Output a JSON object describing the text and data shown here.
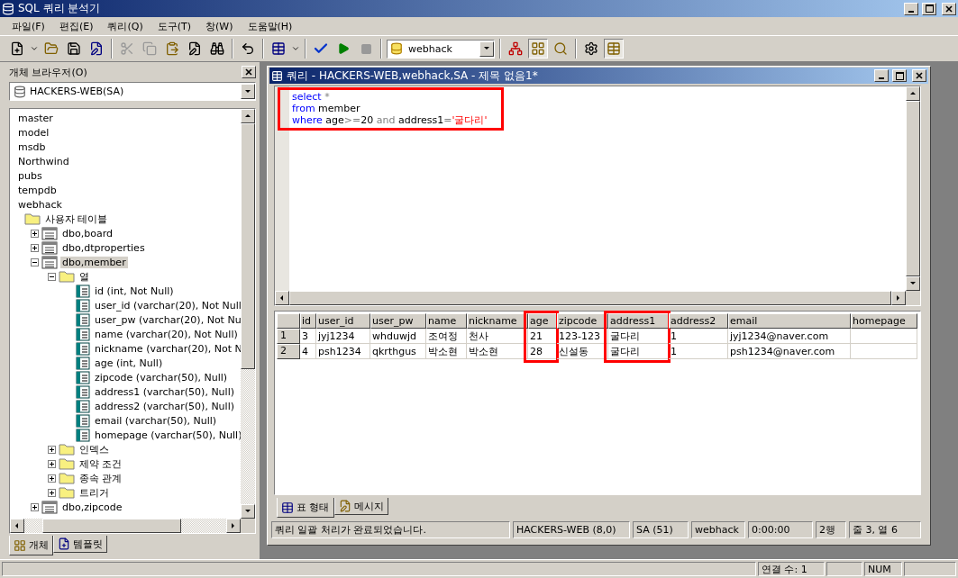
{
  "window": {
    "title": "SQL 쿼리 분석기"
  },
  "menu": [
    {
      "label": "파일(F)"
    },
    {
      "label": "편집(E)"
    },
    {
      "label": "쿼리(Q)"
    },
    {
      "label": "도구(T)"
    },
    {
      "label": "창(W)"
    },
    {
      "label": "도움말(H)"
    }
  ],
  "toolbar": {
    "database": "webhack"
  },
  "object_browser": {
    "title": "개체 브라우저(O)",
    "server": "HACKERS-WEB(SA)",
    "tree": [
      {
        "label": "master",
        "kind": "db",
        "selected": false
      },
      {
        "label": "model",
        "kind": "db",
        "selected": false
      },
      {
        "label": "msdb",
        "kind": "db",
        "selected": false
      },
      {
        "label": "Northwind",
        "kind": "db",
        "selected": false
      },
      {
        "label": "pubs",
        "kind": "db",
        "selected": false
      },
      {
        "label": "tempdb",
        "kind": "db",
        "selected": false
      },
      {
        "label": "webhack",
        "kind": "db",
        "selected": false
      },
      {
        "label": "사용자 테이블",
        "kind": "folder",
        "selected": false,
        "children": [
          {
            "label": "dbo,board",
            "kind": "table",
            "selected": false,
            "expanded": false
          },
          {
            "label": "dbo,dtproperties",
            "kind": "table",
            "selected": false,
            "expanded": false
          },
          {
            "label": "dbo,member",
            "kind": "table",
            "selected": true,
            "expanded": true,
            "children": [
              {
                "label": "열",
                "kind": "folder",
                "selected": false,
                "expanded": true,
                "children": [
                  {
                    "label": "id (int, Not Null)",
                    "kind": "column",
                    "selected": false
                  },
                  {
                    "label": "user_id (varchar(20), Not Null",
                    "kind": "column",
                    "selected": false
                  },
                  {
                    "label": "user_pw (varchar(20), Not Nu",
                    "kind": "column",
                    "selected": false
                  },
                  {
                    "label": "name (varchar(20), Not Null)",
                    "kind": "column",
                    "selected": false
                  },
                  {
                    "label": "nickname (varchar(20), Not N",
                    "kind": "column",
                    "selected": false
                  },
                  {
                    "label": "age (int, Null)",
                    "kind": "column",
                    "selected": false
                  },
                  {
                    "label": "zipcode (varchar(50), Null)",
                    "kind": "column",
                    "selected": false
                  },
                  {
                    "label": "address1 (varchar(50), Null)",
                    "kind": "column",
                    "selected": false
                  },
                  {
                    "label": "address2 (varchar(50), Null)",
                    "kind": "column",
                    "selected": false
                  },
                  {
                    "label": "email (varchar(50), Null)",
                    "kind": "column",
                    "selected": false
                  },
                  {
                    "label": "homepage (varchar(50), Null)",
                    "kind": "column",
                    "selected": false
                  }
                ]
              },
              {
                "label": "인덱스",
                "kind": "folder",
                "selected": false,
                "expanded": false
              },
              {
                "label": "제약 조건",
                "kind": "folder",
                "selected": false,
                "expanded": false
              },
              {
                "label": "종속 관계",
                "kind": "folder",
                "selected": false,
                "expanded": false
              },
              {
                "label": "트리거",
                "kind": "folder",
                "selected": false,
                "expanded": false
              }
            ]
          },
          {
            "label": "dbo,zipcode",
            "kind": "table",
            "selected": false,
            "expanded": false
          }
        ]
      }
    ],
    "tabs": [
      {
        "label": "개체",
        "selected": true
      },
      {
        "label": "템플릿",
        "selected": false
      }
    ]
  },
  "query_window": {
    "title": "쿼리 - HACKERS-WEB,webhack,SA - 제목 없음1*",
    "query": {
      "highlighted": true,
      "lines": [
        [
          {
            "kind": "keyword",
            "text": "select"
          },
          {
            "kind": "operator",
            "text": " *"
          }
        ],
        [
          {
            "kind": "keyword",
            "text": "from"
          },
          {
            "kind": "plain",
            "text": " member"
          }
        ],
        [
          {
            "kind": "keyword",
            "text": "where"
          },
          {
            "kind": "plain",
            "text": " age"
          },
          {
            "kind": "operator",
            "text": ">="
          },
          {
            "kind": "plain",
            "text": "20"
          },
          {
            "kind": "operator",
            "text": " and "
          },
          {
            "kind": "plain",
            "text": "address1"
          },
          {
            "kind": "operator",
            "text": "="
          },
          {
            "kind": "string",
            "text": "'굴다리'"
          }
        ]
      ]
    },
    "grid": {
      "columns": [
        {
          "label": "id",
          "highlighted": false
        },
        {
          "label": "user_id",
          "highlighted": false
        },
        {
          "label": "user_pw",
          "highlighted": false
        },
        {
          "label": "name",
          "highlighted": false
        },
        {
          "label": "nickname",
          "highlighted": false
        },
        {
          "label": "age",
          "highlighted": true
        },
        {
          "label": "zipcode",
          "highlighted": false
        },
        {
          "label": "address1",
          "highlighted": true
        },
        {
          "label": "address2",
          "highlighted": false
        },
        {
          "label": "email",
          "highlighted": false
        },
        {
          "label": "homepage",
          "highlighted": false
        }
      ],
      "rows": [
        {
          "number": "1",
          "cells": [
            "3",
            "jyj1234",
            "whduwjd",
            "조여정",
            "천사",
            "21",
            "123-123",
            "굴다리",
            "1",
            "jyj1234@naver.com",
            ""
          ]
        },
        {
          "number": "2",
          "cells": [
            "4",
            "psh1234",
            "qkrthgus",
            "박소현",
            "박소현",
            "28",
            "신설동",
            "굴다리",
            "1",
            "psh1234@naver.com",
            ""
          ]
        }
      ]
    },
    "tabs": [
      {
        "label": "표 형태",
        "selected": true
      },
      {
        "label": "메시지",
        "selected": false
      }
    ],
    "status": [
      "쿼리 일괄 처리가 완료되었습니다.",
      "HACKERS-WEB (8,0)",
      "SA (51)",
      "webhack",
      "0:00:00",
      "2행",
      "줄 3, 열 6"
    ]
  },
  "status_bar": {
    "connections": "연결 수: 1",
    "num": "NUM"
  }
}
